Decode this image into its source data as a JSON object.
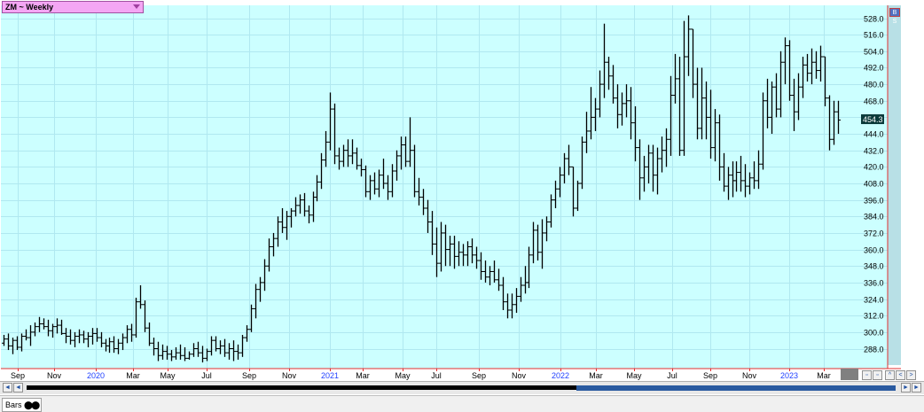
{
  "symbol_label": "ZM ~ Weekly",
  "corner_button_label": "B S",
  "tab_label": "Bars",
  "last_price_label": "454.3",
  "colors": {
    "plot_bg": "#ccffff",
    "grid": "#b0e8f0",
    "bars": "#000000",
    "axis_lines": "#e03030",
    "year_labels": "#2040ff",
    "last_price_bg": "#0a3a3a",
    "right_strip": "#b8e0e6",
    "scroll_thumb": "#2a5aa0"
  },
  "chart_data": {
    "type": "ohlc",
    "title": "ZM ~ Weekly",
    "ylim": [
      276,
      532
    ],
    "y_ticks": [
      "528.0",
      "516.0",
      "504.0",
      "492.0",
      "480.0",
      "468.0",
      "456.0",
      "444.0",
      "432.0",
      "420.0",
      "408.0",
      "396.0",
      "384.0",
      "372.0",
      "360.0",
      "348.0",
      "336.0",
      "324.0",
      "312.0",
      "300.0",
      "288.0"
    ],
    "x_tick_labels": [
      {
        "label": "Sep",
        "year": false
      },
      {
        "label": "Nov",
        "year": false
      },
      {
        "label": "2020",
        "year": true
      },
      {
        "label": "Mar",
        "year": false
      },
      {
        "label": "May",
        "year": false
      },
      {
        "label": "Jul",
        "year": false
      },
      {
        "label": "Sep",
        "year": false
      },
      {
        "label": "Nov",
        "year": false
      },
      {
        "label": "2021",
        "year": true
      },
      {
        "label": "Mar",
        "year": false
      },
      {
        "label": "May",
        "year": false
      },
      {
        "label": "Jul",
        "year": false
      },
      {
        "label": "Sep",
        "year": false
      },
      {
        "label": "Nov",
        "year": false
      },
      {
        "label": "2022",
        "year": true
      },
      {
        "label": "Mar",
        "year": false
      },
      {
        "label": "May",
        "year": false
      },
      {
        "label": "Jul",
        "year": false
      },
      {
        "label": "Sep",
        "year": false
      },
      {
        "label": "Nov",
        "year": false
      },
      {
        "label": "2023",
        "year": true
      },
      {
        "label": "Mar",
        "year": false
      }
    ],
    "bars": [
      [
        292,
        298,
        290,
        295
      ],
      [
        295,
        299,
        287,
        290
      ],
      [
        290,
        296,
        284,
        294
      ],
      [
        294,
        297,
        287,
        289
      ],
      [
        289,
        299,
        286,
        297
      ],
      [
        297,
        302,
        294,
        296
      ],
      [
        296,
        305,
        290,
        300
      ],
      [
        300,
        307,
        297,
        304
      ],
      [
        304,
        311,
        300,
        306
      ],
      [
        306,
        310,
        302,
        304
      ],
      [
        304,
        309,
        297,
        301
      ],
      [
        301,
        306,
        296,
        304
      ],
      [
        304,
        310,
        299,
        305
      ],
      [
        305,
        309,
        298,
        299
      ],
      [
        299,
        303,
        292,
        297
      ],
      [
        297,
        302,
        291,
        294
      ],
      [
        294,
        300,
        289,
        297
      ],
      [
        297,
        302,
        292,
        298
      ],
      [
        298,
        301,
        292,
        295
      ],
      [
        295,
        300,
        289,
        297
      ],
      [
        297,
        303,
        291,
        299
      ],
      [
        299,
        303,
        293,
        296
      ],
      [
        296,
        300,
        289,
        292
      ],
      [
        292,
        295,
        286,
        290
      ],
      [
        290,
        296,
        285,
        293
      ],
      [
        293,
        297,
        285,
        288
      ],
      [
        288,
        295,
        284,
        292
      ],
      [
        292,
        299,
        287,
        296
      ],
      [
        296,
        305,
        292,
        302
      ],
      [
        302,
        306,
        293,
        298
      ],
      [
        298,
        325,
        296,
        322
      ],
      [
        322,
        334,
        317,
        320
      ],
      [
        320,
        323,
        300,
        303
      ],
      [
        303,
        307,
        290,
        292
      ],
      [
        292,
        296,
        283,
        288
      ],
      [
        288,
        293,
        279,
        283
      ],
      [
        283,
        291,
        280,
        286
      ],
      [
        286,
        290,
        280,
        284
      ],
      [
        284,
        287,
        279,
        282
      ],
      [
        282,
        289,
        280,
        285
      ],
      [
        285,
        291,
        280,
        283
      ],
      [
        283,
        289,
        279,
        281
      ],
      [
        281,
        286,
        280,
        284
      ],
      [
        284,
        292,
        282,
        288
      ],
      [
        288,
        293,
        282,
        285
      ],
      [
        285,
        290,
        278,
        281
      ],
      [
        281,
        288,
        279,
        286
      ],
      [
        286,
        297,
        283,
        294
      ],
      [
        294,
        297,
        286,
        288
      ],
      [
        288,
        294,
        284,
        290
      ],
      [
        290,
        295,
        282,
        285
      ],
      [
        285,
        292,
        280,
        288
      ],
      [
        288,
        294,
        279,
        286
      ],
      [
        286,
        291,
        280,
        285
      ],
      [
        285,
        298,
        282,
        296
      ],
      [
        296,
        305,
        293,
        302
      ],
      [
        302,
        320,
        300,
        317
      ],
      [
        317,
        335,
        310,
        331
      ],
      [
        331,
        340,
        322,
        336
      ],
      [
        336,
        353,
        330,
        348
      ],
      [
        348,
        368,
        344,
        362
      ],
      [
        362,
        372,
        355,
        368
      ],
      [
        368,
        384,
        362,
        380
      ],
      [
        380,
        390,
        372,
        376
      ],
      [
        376,
        388,
        367,
        384
      ],
      [
        384,
        390,
        376,
        388
      ],
      [
        388,
        398,
        384,
        392
      ],
      [
        392,
        400,
        386,
        396
      ],
      [
        396,
        401,
        384,
        388
      ],
      [
        388,
        392,
        379,
        385
      ],
      [
        385,
        402,
        380,
        398
      ],
      [
        398,
        414,
        395,
        409
      ],
      [
        409,
        430,
        404,
        425
      ],
      [
        425,
        446,
        420,
        438
      ],
      [
        438,
        474,
        432,
        462
      ],
      [
        462,
        466,
        422,
        428
      ],
      [
        428,
        434,
        418,
        424
      ],
      [
        424,
        436,
        420,
        432
      ],
      [
        432,
        440,
        420,
        428
      ],
      [
        428,
        440,
        422,
        430
      ],
      [
        430,
        434,
        418,
        421
      ],
      [
        421,
        426,
        413,
        418
      ],
      [
        418,
        421,
        398,
        402
      ],
      [
        402,
        414,
        396,
        410
      ],
      [
        410,
        416,
        400,
        404
      ],
      [
        404,
        418,
        398,
        414
      ],
      [
        414,
        426,
        404,
        408
      ],
      [
        408,
        414,
        396,
        402
      ],
      [
        402,
        422,
        398,
        417
      ],
      [
        417,
        432,
        410,
        428
      ],
      [
        428,
        442,
        418,
        436
      ],
      [
        436,
        442,
        420,
        424
      ],
      [
        424,
        456,
        420,
        432
      ],
      [
        432,
        436,
        398,
        402
      ],
      [
        402,
        412,
        392,
        398
      ],
      [
        398,
        404,
        385,
        390
      ],
      [
        390,
        396,
        372,
        380
      ],
      [
        380,
        388,
        356,
        364
      ],
      [
        364,
        376,
        340,
        350
      ],
      [
        350,
        380,
        344,
        372
      ],
      [
        372,
        378,
        348,
        360
      ],
      [
        360,
        370,
        348,
        364
      ],
      [
        364,
        370,
        346,
        355
      ],
      [
        355,
        366,
        348,
        358
      ],
      [
        358,
        364,
        348,
        356
      ],
      [
        356,
        366,
        348,
        362
      ],
      [
        362,
        368,
        350,
        356
      ],
      [
        356,
        362,
        346,
        352
      ],
      [
        352,
        358,
        338,
        344
      ],
      [
        344,
        352,
        336,
        340
      ],
      [
        340,
        348,
        334,
        344
      ],
      [
        344,
        352,
        336,
        338
      ],
      [
        338,
        346,
        330,
        334
      ],
      [
        334,
        340,
        316,
        322
      ],
      [
        322,
        328,
        310,
        316
      ],
      [
        316,
        328,
        310,
        320
      ],
      [
        320,
        332,
        314,
        326
      ],
      [
        326,
        340,
        322,
        334
      ],
      [
        334,
        348,
        328,
        336
      ],
      [
        336,
        362,
        332,
        356
      ],
      [
        356,
        380,
        350,
        374
      ],
      [
        374,
        378,
        352,
        358
      ],
      [
        358,
        382,
        346,
        372
      ],
      [
        372,
        384,
        366,
        380
      ],
      [
        380,
        400,
        376,
        396
      ],
      [
        396,
        410,
        390,
        404
      ],
      [
        404,
        420,
        398,
        414
      ],
      [
        414,
        430,
        408,
        426
      ],
      [
        426,
        436,
        414,
        420
      ],
      [
        420,
        420,
        384,
        390
      ],
      [
        390,
        410,
        388,
        408
      ],
      [
        408,
        442,
        404,
        438
      ],
      [
        438,
        460,
        430,
        446
      ],
      [
        446,
        478,
        440,
        456
      ],
      [
        456,
        470,
        446,
        462
      ],
      [
        462,
        490,
        456,
        480
      ],
      [
        480,
        524,
        470,
        496
      ],
      [
        496,
        500,
        476,
        486
      ],
      [
        486,
        494,
        466,
        470
      ],
      [
        470,
        480,
        448,
        458
      ],
      [
        458,
        474,
        450,
        466
      ],
      [
        466,
        480,
        456,
        468
      ],
      [
        468,
        478,
        440,
        452
      ],
      [
        452,
        464,
        424,
        434
      ],
      [
        434,
        440,
        396,
        412
      ],
      [
        412,
        428,
        402,
        420
      ],
      [
        420,
        436,
        408,
        430
      ],
      [
        430,
        436,
        402,
        414
      ],
      [
        414,
        434,
        400,
        426
      ],
      [
        426,
        442,
        416,
        432
      ],
      [
        432,
        448,
        420,
        440
      ],
      [
        440,
        486,
        428,
        472
      ],
      [
        472,
        502,
        466,
        484
      ],
      [
        484,
        500,
        428,
        432
      ],
      [
        432,
        526,
        428,
        500
      ],
      [
        500,
        530,
        486,
        520
      ],
      [
        520,
        520,
        470,
        480
      ],
      [
        480,
        492,
        440,
        448
      ],
      [
        448,
        492,
        440,
        470
      ],
      [
        470,
        482,
        440,
        456
      ],
      [
        456,
        476,
        426,
        434
      ],
      [
        434,
        462,
        424,
        452
      ],
      [
        452,
        458,
        410,
        420
      ],
      [
        420,
        430,
        402,
        406
      ],
      [
        406,
        420,
        396,
        414
      ],
      [
        414,
        424,
        398,
        410
      ],
      [
        410,
        424,
        402,
        416
      ],
      [
        416,
        428,
        402,
        410
      ],
      [
        410,
        422,
        398,
        406
      ],
      [
        406,
        416,
        400,
        412
      ],
      [
        412,
        424,
        404,
        410
      ],
      [
        410,
        432,
        404,
        422
      ],
      [
        422,
        474,
        418,
        468
      ],
      [
        468,
        484,
        448,
        456
      ],
      [
        456,
        482,
        444,
        478
      ],
      [
        478,
        488,
        456,
        462
      ],
      [
        462,
        504,
        456,
        496
      ],
      [
        496,
        514,
        480,
        508
      ],
      [
        508,
        512,
        468,
        472
      ],
      [
        472,
        484,
        446,
        460
      ],
      [
        460,
        488,
        454,
        478
      ],
      [
        478,
        500,
        470,
        494
      ],
      [
        494,
        502,
        482,
        488
      ],
      [
        488,
        506,
        480,
        496
      ],
      [
        496,
        504,
        484,
        490
      ],
      [
        490,
        508,
        482,
        500
      ],
      [
        500,
        500,
        464,
        470
      ],
      [
        470,
        472,
        432,
        440
      ],
      [
        440,
        468,
        436,
        460
      ],
      [
        460,
        468,
        444,
        454
      ]
    ]
  }
}
